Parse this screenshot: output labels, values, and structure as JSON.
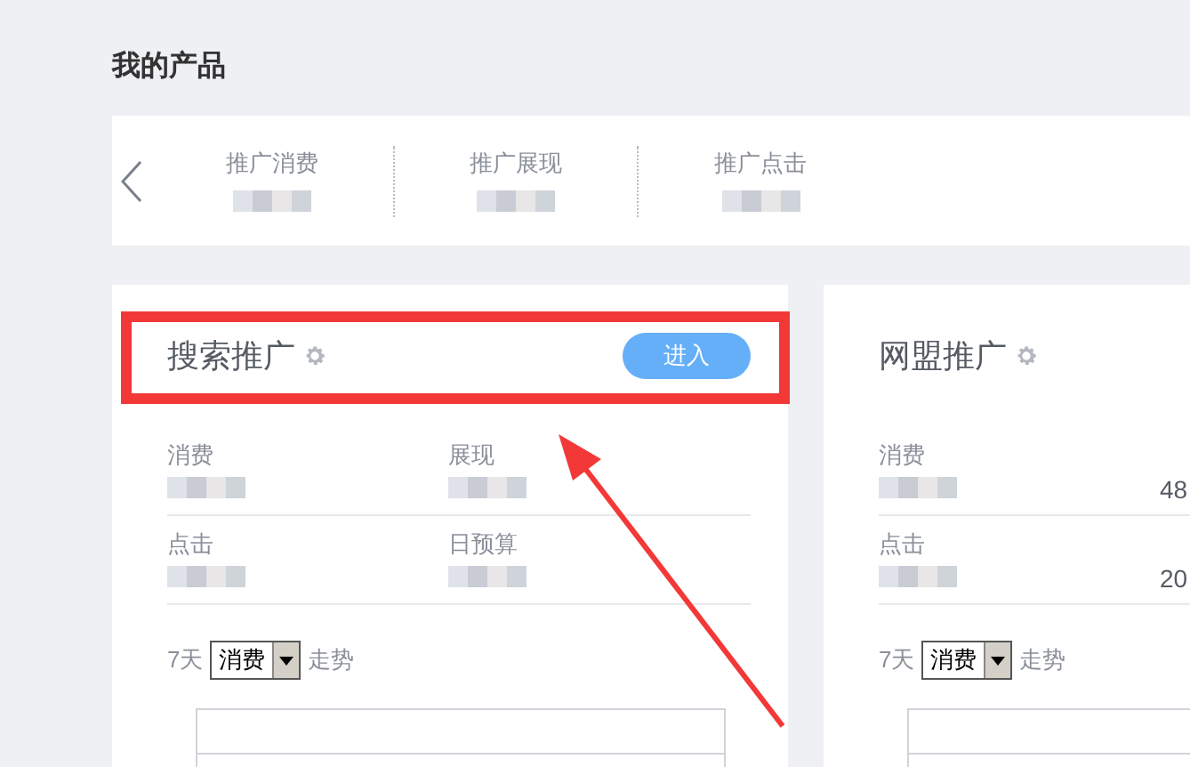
{
  "page_title": "我的产品",
  "summary": {
    "items": [
      {
        "label": "推广消费",
        "blurred": true
      },
      {
        "label": "推广展现",
        "blurred": true
      },
      {
        "label": "推广点击",
        "blurred": true
      }
    ]
  },
  "cards": [
    {
      "title": "搜索推广",
      "button": "进入",
      "highlighted": true,
      "metrics": [
        {
          "label": "消费",
          "blurred": true
        },
        {
          "label": "展现",
          "blurred": true
        },
        {
          "label": "点击",
          "blurred": true
        },
        {
          "label": "日预算",
          "blurred": true
        }
      ],
      "trend": {
        "prefix": "7天",
        "select_value": "消费",
        "suffix": "走势"
      }
    },
    {
      "title": "网盟推广",
      "highlighted": false,
      "metrics": [
        {
          "label": "消费",
          "blurred": true
        },
        {
          "value": "48",
          "blurred": false
        },
        {
          "label": "点击",
          "blurred": true
        },
        {
          "value": "20",
          "blurred": false
        }
      ],
      "trend": {
        "prefix": "7天",
        "select_value": "消费",
        "suffix": "走势"
      }
    }
  ]
}
